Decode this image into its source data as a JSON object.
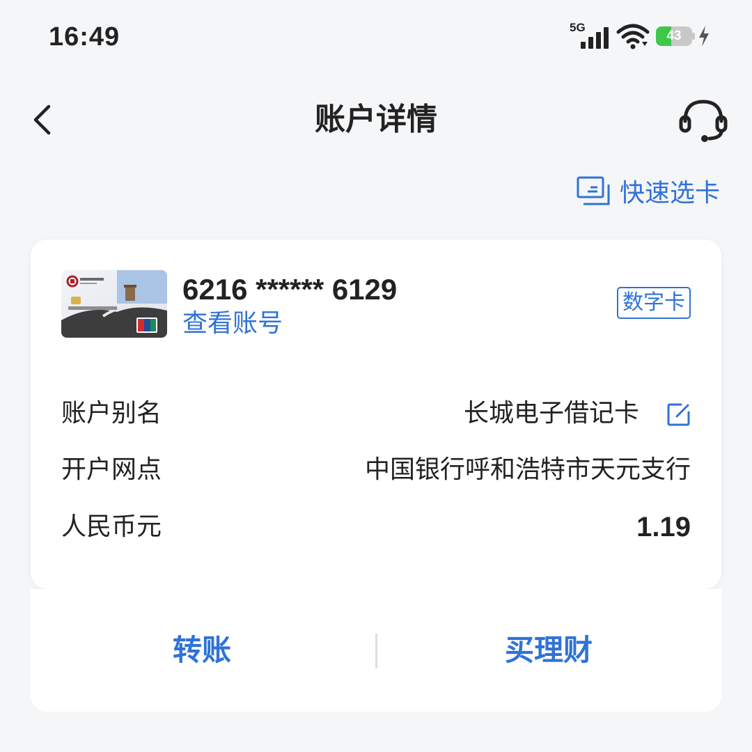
{
  "status_bar": {
    "time": "16:49",
    "network": "5G",
    "battery": "43",
    "battery_level": 0.43,
    "icons": [
      "signal-icon",
      "wifi-icon",
      "battery-icon",
      "charging-bolt-icon"
    ]
  },
  "header": {
    "title": "账户详情",
    "back_icon": "back-arrow-icon",
    "service_icon": "customer-service-headset-icon"
  },
  "quick_select": {
    "label": "快速选卡",
    "icon": "card-switch-icon"
  },
  "card": {
    "number": "6216 ****** 6129",
    "view_account": "查看账号",
    "badge": "数字卡",
    "thumbnail_icon": "bank-card-thumbnail-icon",
    "rows": [
      {
        "label": "账户别名",
        "value": "长城电子借记卡",
        "icon": "edit-icon"
      },
      {
        "label": "开户网点",
        "value": "中国银行呼和浩特市天元支行"
      },
      {
        "label": "人民币元",
        "value": "1.19"
      }
    ]
  },
  "actions": {
    "transfer": "转账",
    "wealth": "买理财"
  },
  "colors": {
    "accent": "#2f72d8",
    "background": "#f5f6f8",
    "card": "#ffffff",
    "text": "#222222",
    "battery_green": "#3ec84a"
  }
}
